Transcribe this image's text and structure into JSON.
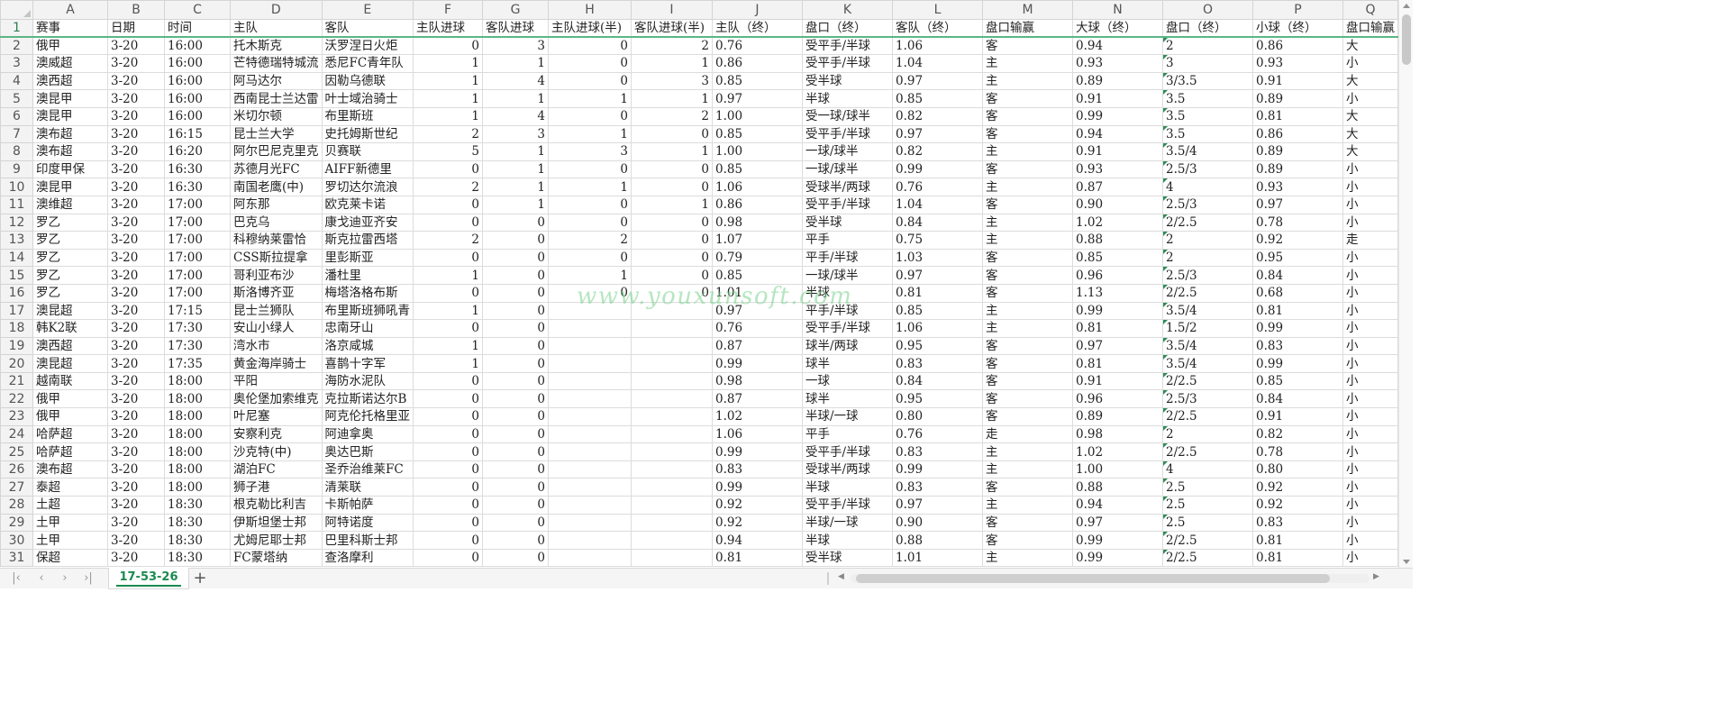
{
  "columns": [
    "A",
    "B",
    "C",
    "D",
    "E",
    "F",
    "G",
    "H",
    "I",
    "J",
    "K",
    "L",
    "M",
    "N",
    "O",
    "P",
    "Q"
  ],
  "header": [
    "赛事",
    "日期",
    "时间",
    "主队",
    "客队",
    "主队进球",
    "客队进球",
    "主队进球(半)",
    "客队进球(半)",
    "主队（终）",
    "盘口（终）",
    "客队（终）",
    "盘口输赢",
    "大球（终）",
    "盘口（终）",
    "小球（终）",
    "盘口输赢"
  ],
  "rows": [
    [
      "俄甲",
      "3-20",
      "16:00",
      "托木斯克",
      "沃罗涅日火炬",
      "0",
      "3",
      "0",
      "2",
      "0.76",
      "受平手/半球",
      "1.06",
      "客",
      "0.94",
      "2",
      "0.86",
      "大"
    ],
    [
      "澳威超",
      "3-20",
      "16:00",
      "芒特德瑞特城流",
      "悉尼FC青年队",
      "1",
      "1",
      "0",
      "1",
      "0.86",
      "受平手/半球",
      "1.04",
      "主",
      "0.93",
      "3",
      "0.93",
      "小"
    ],
    [
      "澳西超",
      "3-20",
      "16:00",
      "阿马达尔",
      "因勒乌德联",
      "1",
      "4",
      "0",
      "3",
      "0.85",
      "受半球",
      "0.97",
      "主",
      "0.89",
      "3/3.5",
      "0.91",
      "大"
    ],
    [
      "澳昆甲",
      "3-20",
      "16:00",
      "西南昆士兰达雷",
      "叶士域治骑士",
      "1",
      "1",
      "1",
      "1",
      "0.97",
      "半球",
      "0.85",
      "客",
      "0.91",
      "3.5",
      "0.89",
      "小"
    ],
    [
      "澳昆甲",
      "3-20",
      "16:00",
      "米切尔顿",
      "布里斯班",
      "1",
      "4",
      "0",
      "2",
      "1.00",
      "受一球/球半",
      "0.82",
      "客",
      "0.99",
      "3.5",
      "0.81",
      "大"
    ],
    [
      "澳布超",
      "3-20",
      "16:15",
      "昆士兰大学",
      "史托姆斯世纪",
      "2",
      "3",
      "1",
      "0",
      "0.85",
      "受平手/半球",
      "0.97",
      "客",
      "0.94",
      "3.5",
      "0.86",
      "大"
    ],
    [
      "澳布超",
      "3-20",
      "16:20",
      "阿尔巴尼克里克",
      "贝赛联",
      "5",
      "1",
      "3",
      "1",
      "1.00",
      "一球/球半",
      "0.82",
      "主",
      "0.91",
      "3.5/4",
      "0.89",
      "大"
    ],
    [
      "印度甲保",
      "3-20",
      "16:30",
      "苏德月光FC",
      "AIFF新德里",
      "0",
      "1",
      "0",
      "0",
      "0.85",
      "一球/球半",
      "0.99",
      "客",
      "0.93",
      "2.5/3",
      "0.89",
      "小"
    ],
    [
      "澳昆甲",
      "3-20",
      "16:30",
      "南国老鹰(中)",
      "罗切达尔流浪",
      "2",
      "1",
      "1",
      "0",
      "1.06",
      "受球半/两球",
      "0.76",
      "主",
      "0.87",
      "4",
      "0.93",
      "小"
    ],
    [
      "澳维超",
      "3-20",
      "17:00",
      "阿东那",
      "欧克莱卡诺",
      "0",
      "1",
      "0",
      "1",
      "0.86",
      "受平手/半球",
      "1.04",
      "客",
      "0.90",
      "2.5/3",
      "0.97",
      "小"
    ],
    [
      "罗乙",
      "3-20",
      "17:00",
      "巴克乌",
      "康戈迪亚齐安",
      "0",
      "0",
      "0",
      "0",
      "0.98",
      "受半球",
      "0.84",
      "主",
      "1.02",
      "2/2.5",
      "0.78",
      "小"
    ],
    [
      "罗乙",
      "3-20",
      "17:00",
      "科穆纳莱雷恰",
      "斯克拉雷西塔",
      "2",
      "0",
      "2",
      "0",
      "1.07",
      "平手",
      "0.75",
      "主",
      "0.88",
      "2",
      "0.92",
      "走"
    ],
    [
      "罗乙",
      "3-20",
      "17:00",
      "CSS斯拉提拿",
      "里彭斯亚",
      "0",
      "0",
      "0",
      "0",
      "0.79",
      "平手/半球",
      "1.03",
      "客",
      "0.85",
      "2",
      "0.95",
      "小"
    ],
    [
      "罗乙",
      "3-20",
      "17:00",
      "哥利亚布沙",
      "潘杜里",
      "1",
      "0",
      "1",
      "0",
      "0.85",
      "一球/球半",
      "0.97",
      "客",
      "0.96",
      "2.5/3",
      "0.84",
      "小"
    ],
    [
      "罗乙",
      "3-20",
      "17:00",
      "斯洛博齐亚",
      "梅塔洛格布斯",
      "0",
      "0",
      "0",
      "0",
      "1.01",
      "半球",
      "0.81",
      "客",
      "1.13",
      "2/2.5",
      "0.68",
      "小"
    ],
    [
      "澳昆超",
      "3-20",
      "17:15",
      "昆士兰狮队",
      "布里斯班狮吼青",
      "1",
      "0",
      "",
      "",
      "0.97",
      "平手/半球",
      "0.85",
      "主",
      "0.99",
      "3.5/4",
      "0.81",
      "小"
    ],
    [
      "韩K2联",
      "3-20",
      "17:30",
      "安山小绿人",
      "忠南牙山",
      "0",
      "0",
      "",
      "",
      "0.76",
      "受平手/半球",
      "1.06",
      "主",
      "0.81",
      "1.5/2",
      "0.99",
      "小"
    ],
    [
      "澳西超",
      "3-20",
      "17:30",
      "湾水市",
      "洛京咸城",
      "1",
      "0",
      "",
      "",
      "0.87",
      "球半/两球",
      "0.95",
      "客",
      "0.97",
      "3.5/4",
      "0.83",
      "小"
    ],
    [
      "澳昆超",
      "3-20",
      "17:35",
      "黄金海岸骑士",
      "喜鹊十字军",
      "1",
      "0",
      "",
      "",
      "0.99",
      "球半",
      "0.83",
      "客",
      "0.81",
      "3.5/4",
      "0.99",
      "小"
    ],
    [
      "越南联",
      "3-20",
      "18:00",
      "平阳",
      "海防水泥队",
      "0",
      "0",
      "",
      "",
      "0.98",
      "一球",
      "0.84",
      "客",
      "0.91",
      "2/2.5",
      "0.85",
      "小"
    ],
    [
      "俄甲",
      "3-20",
      "18:00",
      "奥伦堡加索维克",
      "克拉斯诺达尔B",
      "0",
      "0",
      "",
      "",
      "0.87",
      "球半",
      "0.95",
      "客",
      "0.96",
      "2.5/3",
      "0.84",
      "小"
    ],
    [
      "俄甲",
      "3-20",
      "18:00",
      "叶尼塞",
      "阿克伦托格里亚",
      "0",
      "0",
      "",
      "",
      "1.02",
      "半球/一球",
      "0.80",
      "客",
      "0.89",
      "2/2.5",
      "0.91",
      "小"
    ],
    [
      "哈萨超",
      "3-20",
      "18:00",
      "安察利克",
      "阿迪拿奥",
      "0",
      "0",
      "",
      "",
      "1.06",
      "平手",
      "0.76",
      "走",
      "0.98",
      "2",
      "0.82",
      "小"
    ],
    [
      "哈萨超",
      "3-20",
      "18:00",
      "沙克特(中)",
      "奥达巴斯",
      "0",
      "0",
      "",
      "",
      "0.99",
      "受平手/半球",
      "0.83",
      "主",
      "1.02",
      "2/2.5",
      "0.78",
      "小"
    ],
    [
      "澳布超",
      "3-20",
      "18:00",
      "湖泊FC",
      "圣乔治维莱FC",
      "0",
      "0",
      "",
      "",
      "0.83",
      "受球半/两球",
      "0.99",
      "主",
      "1.00",
      "4",
      "0.80",
      "小"
    ],
    [
      "泰超",
      "3-20",
      "18:00",
      "狮子港",
      "清莱联",
      "0",
      "0",
      "",
      "",
      "0.99",
      "半球",
      "0.83",
      "客",
      "0.88",
      "2.5",
      "0.92",
      "小"
    ],
    [
      "土超",
      "3-20",
      "18:30",
      "根克勒比利吉",
      "卡斯帕萨",
      "0",
      "0",
      "",
      "",
      "0.92",
      "受平手/半球",
      "0.97",
      "主",
      "0.94",
      "2.5",
      "0.92",
      "小"
    ],
    [
      "土甲",
      "3-20",
      "18:30",
      "伊斯坦堡士邦",
      "阿特诺度",
      "0",
      "0",
      "",
      "",
      "0.92",
      "半球/一球",
      "0.90",
      "客",
      "0.97",
      "2.5",
      "0.83",
      "小"
    ],
    [
      "土甲",
      "3-20",
      "18:30",
      "尤姆尼耶士邦",
      "巴里科斯士邦",
      "0",
      "0",
      "",
      "",
      "0.94",
      "半球",
      "0.88",
      "客",
      "0.99",
      "2/2.5",
      "0.81",
      "小"
    ],
    [
      "保超",
      "3-20",
      "18:30",
      "FC蒙塔纳",
      "查洛摩利",
      "0",
      "0",
      "",
      "",
      "0.81",
      "受半球",
      "1.01",
      "主",
      "0.99",
      "2/2.5",
      "0.81",
      "小"
    ]
  ],
  "watermark": "www.youxunsoft.com",
  "sheet_tabs": [
    "17-53-26"
  ],
  "accent_color": "#1a8a4f"
}
